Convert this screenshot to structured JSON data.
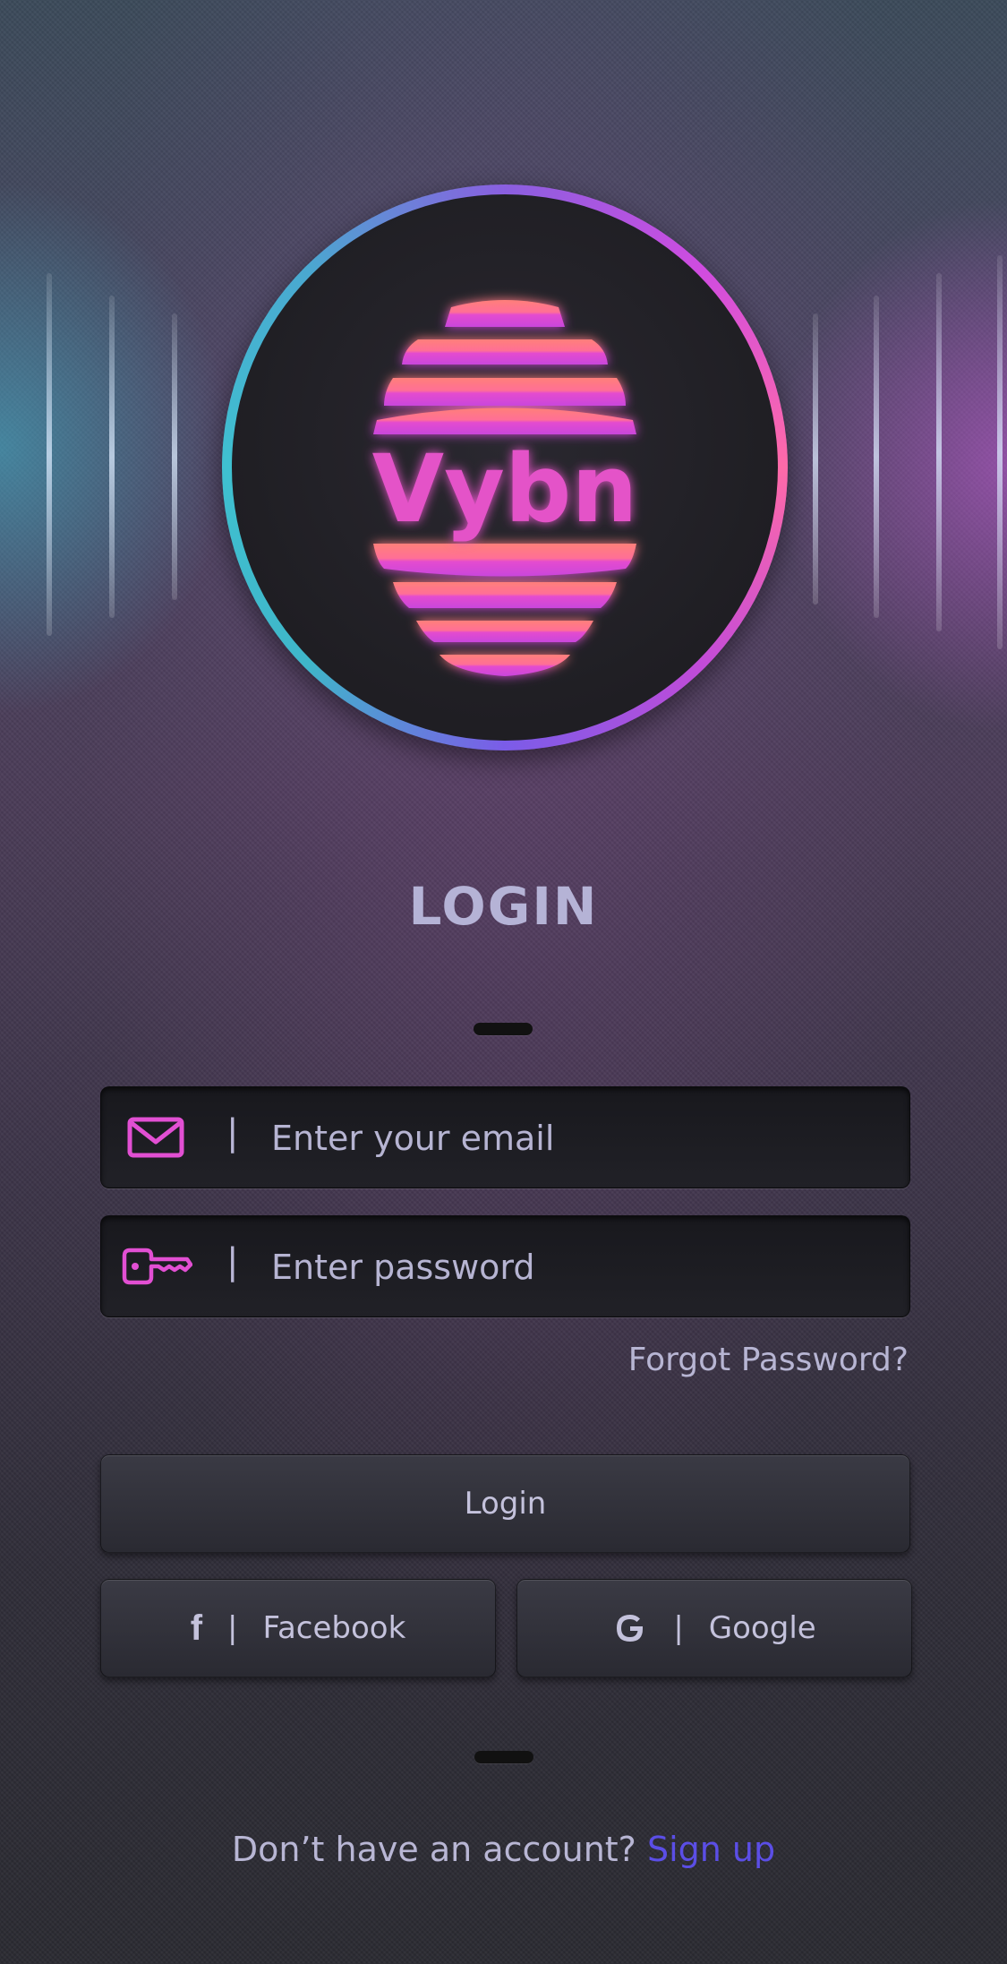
{
  "brand": {
    "logo_text": "Vybn",
    "accent_pink": "#e24fd3",
    "accent_coral": "#ff7a7a",
    "ring_cyan": "#3fc0d0",
    "ring_magenta": "#d04ce0"
  },
  "login": {
    "title": "LOGIN",
    "email": {
      "icon": "mail-icon",
      "separator": "|",
      "placeholder": "Enter your email",
      "value": ""
    },
    "password": {
      "icon": "key-icon",
      "separator": "|",
      "placeholder": "Enter password",
      "value": ""
    },
    "forgot_label": "Forgot Password?",
    "login_button_label": "Login"
  },
  "social": {
    "facebook": {
      "icon": "facebook-icon",
      "separator": "|",
      "label": "Facebook"
    },
    "google": {
      "icon": "google-icon",
      "separator": "|",
      "label": "Google"
    }
  },
  "footer": {
    "prompt": "Don’t have an account?",
    "signup_label": "Sign up",
    "link_color": "#5b4ee6"
  }
}
